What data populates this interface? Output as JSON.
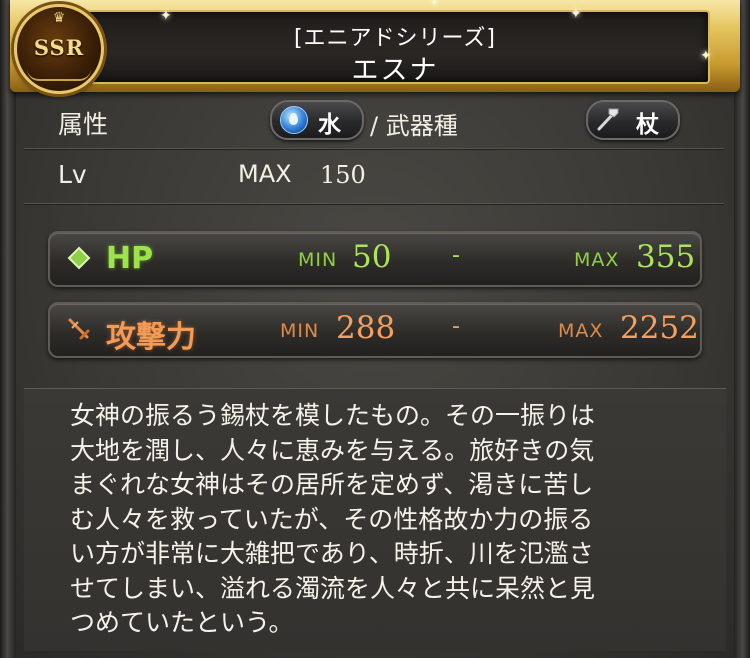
{
  "header": {
    "series": "[エニアドシリーズ]",
    "name": "エスナ",
    "rarity": "SSR"
  },
  "attribute_row": {
    "label": "属性",
    "element": {
      "icon": "water-element-icon",
      "text": "水",
      "color": "#2f7fd8"
    },
    "separator": "/ 武器種",
    "weapon_type": {
      "icon": "staff-icon",
      "text": "杖"
    }
  },
  "level_row": {
    "label": "Lv",
    "max_label": "MAX",
    "max_value": "150"
  },
  "stats": {
    "hp": {
      "name": "HP",
      "min_label": "MIN",
      "min_value": "50",
      "dash": "-",
      "max_label": "MAX",
      "max_value": "355",
      "color": "#9fe34b"
    },
    "attack": {
      "name": "攻撃力",
      "min_label": "MIN",
      "min_value": "288",
      "dash": "-",
      "max_label": "MAX",
      "max_value": "2252",
      "color": "#f39a55"
    }
  },
  "description": "女神の振るう錫杖を模したもの。その一振りは\n大地を潤し、人々に恵みを与える。旅好きの気\nまぐれな女神はその居所を定めず、渇きに苦し\nむ人々を救っていたが、その性格故か力の振る\nい方が非常に大雑把であり、時折、川を氾濫さ\nせてしまい、溢れる濁流を人々と共に呆然と見\nつめていたという。"
}
